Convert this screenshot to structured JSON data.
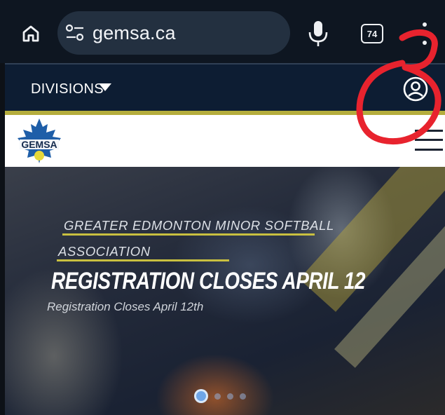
{
  "browser": {
    "url": "gemsa.ca",
    "tab_count": "74",
    "icons": [
      "home-icon",
      "site-settings-icon",
      "microphone-icon",
      "tabs-icon",
      "more-vert-icon"
    ]
  },
  "site_nav": {
    "divisions_label": "DIVISIONS",
    "icons": [
      "caret-down-icon",
      "account-circle-icon"
    ]
  },
  "logo_bar": {
    "logo_text": "GEMSA",
    "icons": [
      "hamburger-menu-icon"
    ]
  },
  "hero": {
    "org_name_line1": "GREATER EDMONTON MINOR SOFTBALL",
    "org_name_line2": "ASSOCIATION",
    "headline": "REGISTRATION CLOSES APRIL 12",
    "caption": "Registration Closes April 12th",
    "slide_count": 4,
    "active_slide": 1
  },
  "colors": {
    "chrome_bg": "#0e1621",
    "urlbar_bg": "#233040",
    "nav_bg": "#0d1d33",
    "accent_gold": "#b5ad3d",
    "annotation_red": "#e8232e",
    "dot_active": "#6ea6e8"
  }
}
